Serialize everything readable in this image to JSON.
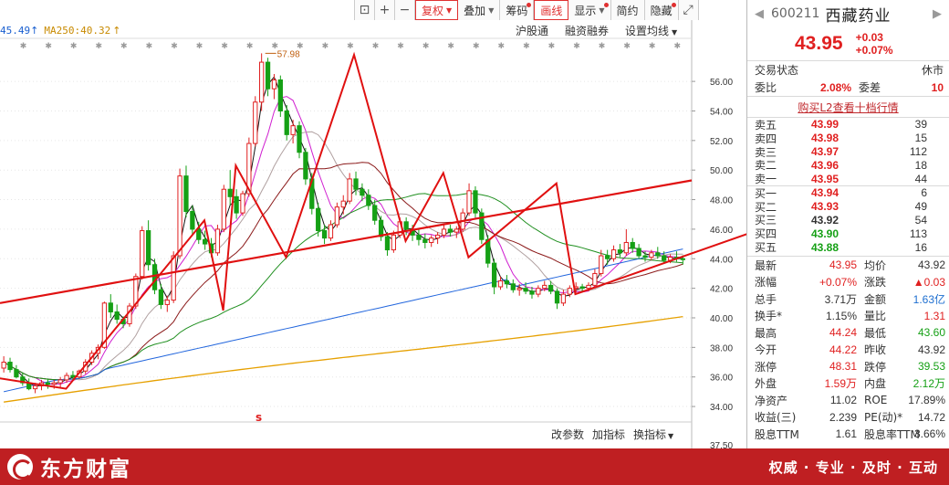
{
  "toolbar": {
    "items": [
      {
        "label": "",
        "icon": "lock-icon",
        "glyph": "⊡"
      },
      {
        "label": "",
        "icon": "plus-icon",
        "glyph": "+"
      },
      {
        "label": "",
        "icon": "minus-icon",
        "glyph": "−"
      },
      {
        "label": "复权",
        "dropdown": true,
        "active": true
      },
      {
        "label": "叠加",
        "dropdown": true
      },
      {
        "label": "筹码",
        "dot": true
      },
      {
        "label": "画线",
        "active": true
      },
      {
        "label": "显示",
        "dropdown": true,
        "dot": true
      },
      {
        "label": "简约"
      },
      {
        "label": "隐藏",
        "dot": true
      },
      {
        "label": "",
        "icon": "fullscreen-icon",
        "glyph": "⤢"
      }
    ]
  },
  "legend": {
    "ma_a": "45.49",
    "ma_a_arrow": "↑",
    "ma_b": "MA250:40.32",
    "ma_b_arrow": "↑"
  },
  "subbar": {
    "hk_connect": "沪股通",
    "margin": "融资融券",
    "ma_setting": "设置均线"
  },
  "bottombar": {
    "param": "改参数",
    "add_indicator": "加指标",
    "switch_indicator": "换指标"
  },
  "chart_data": {
    "type": "candlestick",
    "ylim": [
      33.2,
      57.8
    ],
    "y_ticks": [
      "56.00",
      "54.00",
      "52.00",
      "50.00",
      "48.00",
      "46.00",
      "44.00",
      "42.00",
      "40.00",
      "38.00",
      "36.00",
      "34.00"
    ],
    "y_ticks_bottom": [
      "37.50"
    ],
    "max_label": "57.98",
    "marker": "s",
    "zigzag_highs_lows": [
      35.9,
      35.2,
      46.6,
      40.5,
      50.3,
      44.1,
      57.8,
      45.2,
      49.8,
      44.1,
      49.1,
      41.6,
      46.0
    ],
    "trendline": [
      41.0,
      49.3
    ],
    "candles": [
      [
        36.6,
        37.4,
        36.3,
        37.0
      ],
      [
        37.0,
        37.3,
        36.3,
        36.5
      ],
      [
        36.5,
        36.8,
        35.9,
        36.0
      ],
      [
        36.0,
        36.3,
        35.4,
        35.6
      ],
      [
        35.6,
        35.9,
        35.1,
        35.2
      ],
      [
        35.2,
        35.6,
        34.9,
        35.4
      ],
      [
        35.4,
        35.8,
        35.1,
        35.6
      ],
      [
        35.6,
        35.9,
        35.2,
        35.5
      ],
      [
        35.5,
        35.8,
        35.2,
        35.6
      ],
      [
        35.6,
        36.0,
        35.3,
        35.8
      ],
      [
        35.8,
        36.3,
        35.6,
        36.1
      ],
      [
        36.1,
        36.4,
        35.8,
        36.0
      ],
      [
        36.0,
        36.5,
        35.9,
        36.4
      ],
      [
        36.4,
        37.2,
        36.2,
        37.0
      ],
      [
        37.0,
        37.8,
        36.8,
        37.6
      ],
      [
        37.6,
        38.2,
        37.2,
        38.0
      ],
      [
        38.0,
        41.1,
        37.9,
        41.0
      ],
      [
        41.0,
        41.6,
        40.0,
        40.4
      ],
      [
        40.4,
        40.9,
        39.6,
        39.9
      ],
      [
        39.9,
        40.1,
        39.3,
        39.6
      ],
      [
        39.6,
        41.0,
        39.4,
        40.8
      ],
      [
        40.8,
        43.0,
        40.6,
        42.8
      ],
      [
        42.8,
        46.2,
        42.6,
        45.9
      ],
      [
        45.9,
        46.6,
        43.2,
        43.6
      ],
      [
        43.6,
        44.0,
        41.6,
        41.9
      ],
      [
        41.9,
        42.3,
        40.6,
        40.9
      ],
      [
        40.9,
        41.5,
        40.4,
        41.2
      ],
      [
        41.2,
        44.5,
        41.0,
        44.2
      ],
      [
        44.2,
        50.1,
        44.0,
        49.6
      ],
      [
        49.6,
        50.3,
        46.8,
        47.2
      ],
      [
        47.2,
        47.6,
        45.6,
        46.0
      ],
      [
        46.0,
        46.5,
        45.0,
        45.3
      ],
      [
        45.3,
        45.9,
        44.6,
        45.0
      ],
      [
        45.0,
        45.4,
        44.1,
        44.4
      ],
      [
        44.4,
        46.3,
        44.2,
        46.0
      ],
      [
        46.0,
        49.0,
        45.8,
        48.7
      ],
      [
        48.7,
        50.0,
        47.6,
        48.2
      ],
      [
        48.2,
        48.7,
        46.7,
        47.1
      ],
      [
        47.1,
        48.6,
        46.9,
        48.4
      ],
      [
        48.4,
        52.2,
        48.2,
        51.8
      ],
      [
        51.8,
        55.0,
        51.6,
        54.6
      ],
      [
        54.6,
        57.9,
        54.0,
        57.3
      ],
      [
        57.3,
        57.6,
        55.0,
        55.5
      ],
      [
        55.5,
        56.5,
        54.8,
        56.1
      ],
      [
        56.1,
        56.4,
        53.6,
        54.0
      ],
      [
        54.0,
        54.4,
        52.0,
        52.4
      ],
      [
        52.4,
        53.4,
        51.8,
        53.0
      ],
      [
        53.0,
        53.3,
        50.8,
        51.2
      ],
      [
        51.2,
        51.5,
        49.0,
        49.4
      ],
      [
        49.4,
        49.8,
        47.0,
        47.4
      ],
      [
        47.4,
        47.8,
        45.5,
        45.9
      ],
      [
        45.9,
        46.3,
        45.0,
        45.4
      ],
      [
        45.4,
        46.6,
        45.2,
        46.3
      ],
      [
        46.3,
        47.8,
        46.1,
        47.5
      ],
      [
        47.5,
        48.3,
        47.0,
        47.9
      ],
      [
        47.9,
        49.8,
        47.7,
        49.4
      ],
      [
        49.4,
        49.9,
        48.3,
        48.7
      ],
      [
        48.7,
        49.1,
        47.9,
        48.3
      ],
      [
        48.3,
        48.7,
        47.3,
        47.6
      ],
      [
        47.6,
        48.0,
        46.3,
        46.6
      ],
      [
        46.6,
        46.9,
        45.2,
        45.5
      ],
      [
        45.5,
        45.8,
        44.2,
        44.6
      ],
      [
        44.6,
        45.9,
        44.4,
        45.6
      ],
      [
        45.6,
        46.8,
        45.4,
        46.5
      ],
      [
        46.5,
        46.8,
        45.6,
        46.0
      ],
      [
        46.0,
        46.3,
        45.2,
        45.6
      ],
      [
        45.6,
        46.0,
        44.9,
        45.3
      ],
      [
        45.3,
        45.7,
        44.7,
        45.1
      ],
      [
        45.1,
        45.6,
        44.8,
        45.4
      ],
      [
        45.4,
        45.8,
        45.0,
        45.6
      ],
      [
        45.6,
        46.3,
        45.4,
        46.0
      ],
      [
        46.0,
        46.3,
        45.5,
        45.8
      ],
      [
        45.8,
        46.2,
        45.4,
        46.0
      ],
      [
        46.0,
        47.4,
        45.8,
        47.1
      ],
      [
        47.1,
        49.1,
        46.9,
        48.6
      ],
      [
        48.6,
        48.9,
        46.8,
        47.1
      ],
      [
        47.1,
        47.4,
        45.0,
        45.3
      ],
      [
        45.3,
        45.6,
        43.4,
        43.7
      ],
      [
        43.7,
        44.0,
        41.6,
        42.1
      ],
      [
        42.1,
        42.8,
        41.9,
        42.5
      ],
      [
        42.5,
        42.9,
        42.0,
        42.3
      ],
      [
        42.3,
        42.6,
        41.7,
        41.9
      ],
      [
        41.9,
        42.3,
        41.5,
        42.0
      ],
      [
        42.0,
        42.4,
        41.6,
        41.8
      ],
      [
        41.8,
        42.1,
        41.3,
        41.6
      ],
      [
        41.6,
        42.2,
        41.4,
        42.0
      ],
      [
        42.0,
        42.5,
        41.8,
        42.2
      ],
      [
        42.2,
        42.5,
        41.6,
        41.8
      ],
      [
        41.8,
        42.0,
        40.6,
        41.0
      ],
      [
        41.0,
        41.9,
        40.8,
        41.6
      ],
      [
        41.6,
        42.2,
        41.4,
        42.0
      ],
      [
        42.0,
        42.4,
        41.7,
        42.1
      ],
      [
        42.1,
        42.3,
        41.8,
        42.0
      ],
      [
        42.0,
        42.4,
        41.8,
        42.2
      ],
      [
        42.2,
        43.3,
        42.0,
        43.0
      ],
      [
        43.0,
        44.6,
        42.8,
        44.2
      ],
      [
        44.2,
        44.6,
        43.6,
        44.0
      ],
      [
        44.0,
        44.9,
        43.8,
        44.6
      ],
      [
        44.6,
        45.0,
        44.1,
        44.4
      ],
      [
        44.4,
        46.0,
        44.2,
        45.1
      ],
      [
        45.1,
        45.4,
        44.4,
        44.7
      ],
      [
        44.7,
        45.0,
        44.0,
        44.2
      ],
      [
        44.2,
        44.5,
        43.8,
        44.1
      ],
      [
        44.1,
        44.6,
        43.9,
        44.4
      ],
      [
        44.4,
        44.8,
        44.0,
        44.2
      ],
      [
        44.2,
        44.5,
        43.7,
        43.9
      ],
      [
        43.9,
        44.3,
        43.7,
        44.1
      ],
      [
        44.1,
        44.5,
        43.8,
        44.0
      ],
      [
        44.0,
        44.24,
        43.6,
        43.95
      ]
    ]
  },
  "panel": {
    "nav_prev": "◀",
    "nav_next": "▶",
    "code": "600211",
    "name": "西藏药业",
    "price": "43.95",
    "change": "+0.03",
    "change_pct": "+0.07%",
    "trade_status_label": "交易状态",
    "trade_status": "休市",
    "wb_label": "委比",
    "wb_value": "2.08%",
    "wc_label": "委差",
    "wc_value": "10",
    "l2_link": "购买L2查看十档行情",
    "asks": [
      {
        "label": "卖五",
        "price": "43.99",
        "vol": "39"
      },
      {
        "label": "卖四",
        "price": "43.98",
        "vol": "15"
      },
      {
        "label": "卖三",
        "price": "43.97",
        "vol": "112"
      },
      {
        "label": "卖二",
        "price": "43.96",
        "vol": "18"
      },
      {
        "label": "卖一",
        "price": "43.95",
        "vol": "44"
      }
    ],
    "bids": [
      {
        "label": "买一",
        "price": "43.94",
        "vol": "6",
        "color": "red"
      },
      {
        "label": "买二",
        "price": "43.93",
        "vol": "49",
        "color": "red"
      },
      {
        "label": "买三",
        "price": "43.92",
        "vol": "54",
        "color": "black"
      },
      {
        "label": "买四",
        "price": "43.90",
        "vol": "113",
        "color": "green"
      },
      {
        "label": "买五",
        "price": "43.88",
        "vol": "16",
        "color": "green"
      }
    ],
    "stats": [
      {
        "l1": "最新",
        "v1": "43.95",
        "c1": "red",
        "l2": "均价",
        "v2": "43.92",
        "c2": "black"
      },
      {
        "l1": "涨幅",
        "v1": "+0.07%",
        "c1": "red",
        "l2": "涨跌",
        "v2": "▲0.03",
        "c2": "red"
      },
      {
        "l1": "总手",
        "v1": "3.71万",
        "c1": "black",
        "l2": "金额",
        "v2": "1.63亿",
        "c2": "blue"
      },
      {
        "l1": "换手*",
        "v1": "1.15%",
        "c1": "black",
        "l2": "量比",
        "v2": "1.31",
        "c2": "red"
      },
      {
        "l1": "最高",
        "v1": "44.24",
        "c1": "red",
        "l2": "最低",
        "v2": "43.60",
        "c2": "green"
      },
      {
        "l1": "今开",
        "v1": "44.22",
        "c1": "red",
        "l2": "昨收",
        "v2": "43.92",
        "c2": "black"
      },
      {
        "l1": "涨停",
        "v1": "48.31",
        "c1": "red",
        "l2": "跌停",
        "v2": "39.53",
        "c2": "green"
      },
      {
        "l1": "外盘",
        "v1": "1.59万",
        "c1": "red",
        "l2": "内盘",
        "v2": "2.12万",
        "c2": "green"
      },
      {
        "l1": "净资产",
        "v1": "11.02",
        "c1": "black",
        "l2": "ROE",
        "v2": "17.89%",
        "c2": "black"
      },
      {
        "l1": "收益(三)",
        "v1": "2.239",
        "c1": "black",
        "l2": "PE(动)*",
        "v2": "14.72",
        "c2": "black"
      },
      {
        "l1": "股息TTM",
        "v1": "1.61",
        "c1": "black",
        "l2": "股息率TTM",
        "v2": "3.66%",
        "c2": "black"
      }
    ]
  },
  "footer": {
    "brand": "东方财富",
    "slogan": "权威 · 专业 · 及时 · 互动"
  },
  "colors": {
    "up": "#e02020",
    "down": "#15a015",
    "zigzag": "#e01010",
    "brand": "#bf1f22"
  }
}
